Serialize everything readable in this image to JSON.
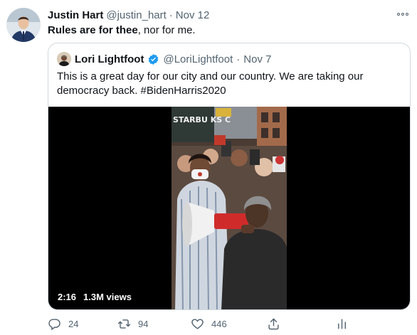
{
  "tweet": {
    "author_name": "Justin Hart",
    "handle": "@justin_hart",
    "separator": "·",
    "date": "Nov 12",
    "text_bold": "Rules are for thee",
    "text_rest": ", nor for me."
  },
  "quote": {
    "author_name": "Lori Lightfoot",
    "handle": "@LoriLightfoot",
    "separator": "·",
    "date": "Nov 7",
    "text": "This is a great day for our city and our country. We are taking our democracy back. #BidenHarris2020",
    "video": {
      "duration": "2:16",
      "views": "1.3M views",
      "sign_text": "STARBU KS C"
    }
  },
  "actions": {
    "reply_count": "24",
    "retweet_count": "94",
    "like_count": "446"
  },
  "colors": {
    "verified": "#1d9bf0",
    "muted": "#536471",
    "border": "#cfd9de"
  }
}
